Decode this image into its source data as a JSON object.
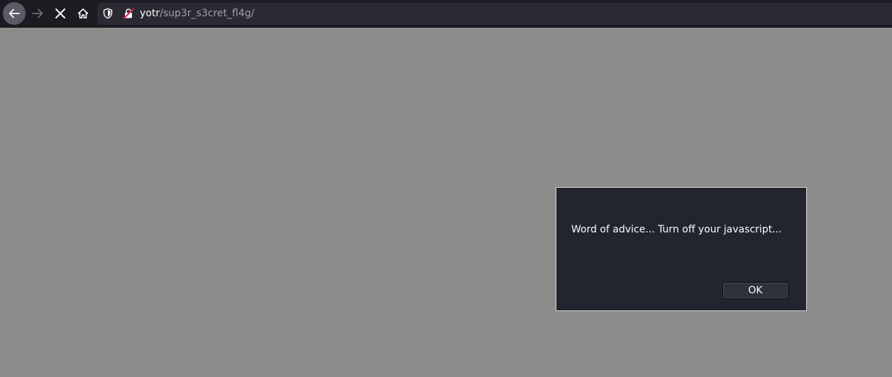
{
  "browser": {
    "url_host": "yotr",
    "url_path": "/sup3r_s3cret_fl4g/",
    "icons": {
      "back": "arrow-left-icon",
      "forward": "arrow-right-icon",
      "stop": "close-icon",
      "home": "home-icon",
      "tracking": "shield-icon",
      "security": "insecure-lock-icon"
    }
  },
  "page": {
    "background_color": "#8c8c8c"
  },
  "dialog": {
    "message": "Word of advice... Turn off your javascript...",
    "ok_label": "OK"
  }
}
